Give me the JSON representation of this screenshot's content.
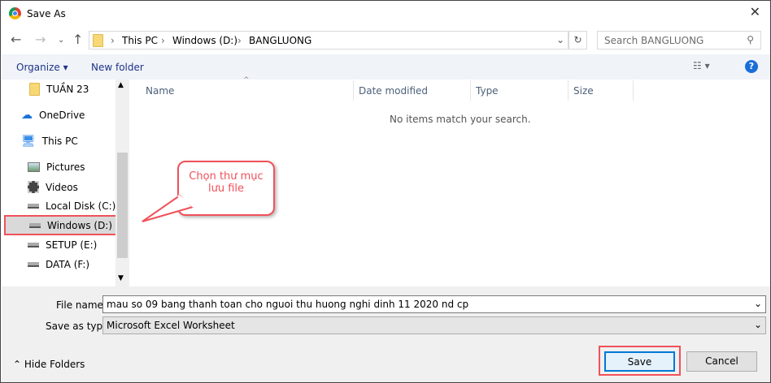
{
  "window": {
    "title": "Save As"
  },
  "breadcrumb": [
    "This PC",
    "Windows (D:)",
    "BANGLUONG"
  ],
  "search": {
    "placeholder": "Search BANGLUONG"
  },
  "toolbar": {
    "organize": "Organize",
    "new_folder": "New folder"
  },
  "sidebar": {
    "items": [
      "TUẦN 23",
      "OneDrive",
      "This PC",
      "Pictures",
      "Videos",
      "Local Disk (C:)",
      "Windows (D:)",
      "SETUP (E:)",
      "DATA (F:)"
    ]
  },
  "columns": [
    "Name",
    "Date modified",
    "Type",
    "Size"
  ],
  "empty_message": "No items match your search.",
  "callout": {
    "text": "Chọn thư mục lưu file"
  },
  "form": {
    "file_name_label": "File name:",
    "file_name": "mau so 09 bang thanh toan cho nguoi thu huong nghi dinh 11 2020 nd cp",
    "type_label": "Save as type:",
    "type": "Microsoft Excel Worksheet"
  },
  "buttons": {
    "hide_folders": "Hide Folders",
    "save": "Save",
    "cancel": "Cancel"
  }
}
